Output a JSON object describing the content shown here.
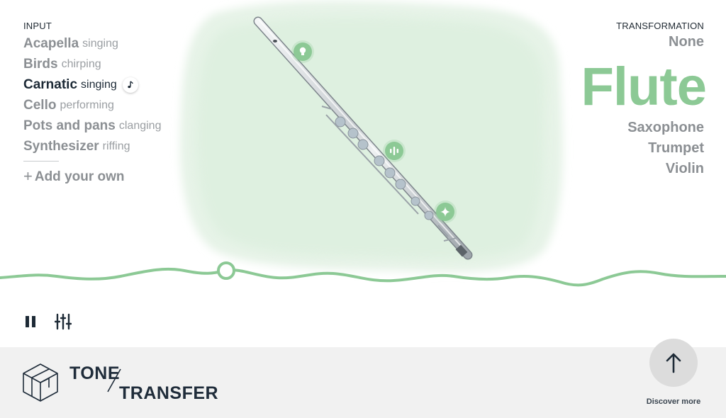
{
  "input": {
    "section_label": "INPUT",
    "items": [
      {
        "main": "Acapella",
        "sub": "singing",
        "active": false
      },
      {
        "main": "Birds",
        "sub": "chirping",
        "active": false
      },
      {
        "main": "Carnatic",
        "sub": "singing",
        "active": true
      },
      {
        "main": "Cello",
        "sub": "performing",
        "active": false
      },
      {
        "main": "Pots and pans",
        "sub": "clanging",
        "active": false
      },
      {
        "main": "Synthesizer",
        "sub": "riffing",
        "active": false
      }
    ],
    "add_own_plus": "+",
    "add_own_label": "Add your own",
    "active_icon": "music-note-icon"
  },
  "transformation": {
    "section_label": "TRANSFORMATION",
    "items": [
      {
        "label": "None",
        "active": false
      },
      {
        "label": "Flute",
        "active": true
      },
      {
        "label": "Saxophone",
        "active": false
      },
      {
        "label": "Trumpet",
        "active": false
      },
      {
        "label": "Violin",
        "active": false
      }
    ]
  },
  "hotspots": [
    {
      "icon": "lightbulb-icon"
    },
    {
      "icon": "audio-bars-icon"
    },
    {
      "icon": "sparkle-icon"
    }
  ],
  "player": {
    "state": "playing",
    "progress": 0.31,
    "pause_icon": "pause-icon",
    "mixer_icon": "mixer-sliders-icon"
  },
  "footer": {
    "brand_line1": "TONE",
    "brand_line2": "TRANSFER",
    "discover_label": "Discover more",
    "discover_icon": "arrow-up-icon"
  },
  "colors": {
    "accent": "#8cc995",
    "text_dark": "#1d2a36",
    "text_muted": "#8b8f93",
    "footer_bg": "#f1f1f1"
  }
}
